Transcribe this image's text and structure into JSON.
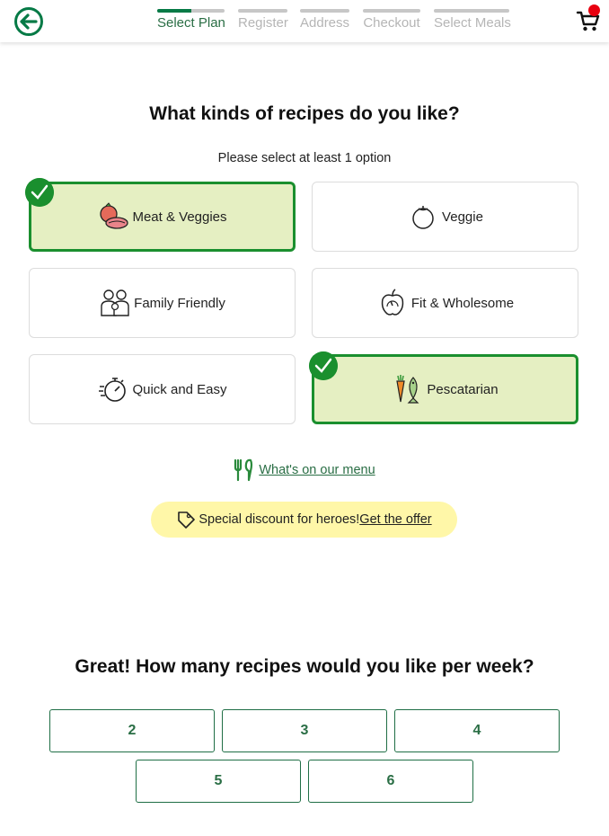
{
  "header": {
    "steps": [
      {
        "label": "Select Plan",
        "progress": 0.5,
        "active": true
      },
      {
        "label": "Register",
        "progress": 0,
        "active": false
      },
      {
        "label": "Address",
        "progress": 0,
        "active": false
      },
      {
        "label": "Checkout",
        "progress": 0,
        "active": false
      },
      {
        "label": "Select Meals",
        "progress": 0,
        "active": false
      }
    ],
    "cart_has_badge": true
  },
  "preferences": {
    "title": "What kinds of recipes do you like?",
    "hint": "Please select at least 1 option",
    "options": [
      {
        "label": "Meat & Veggies",
        "icon": "meat-veggies-icon",
        "selected": true
      },
      {
        "label": "Veggie",
        "icon": "veggie-icon",
        "selected": false
      },
      {
        "label": "Family Friendly",
        "icon": "family-icon",
        "selected": false
      },
      {
        "label": "Fit & Wholesome",
        "icon": "fit-apple-icon",
        "selected": false
      },
      {
        "label": "Quick and Easy",
        "icon": "stopwatch-icon",
        "selected": false
      },
      {
        "label": "Pescatarian",
        "icon": "fish-carrot-icon",
        "selected": true
      }
    ]
  },
  "menu_link": {
    "label": "What's on our menu",
    "icon": "fork-icon"
  },
  "promo": {
    "text": "Special discount for heroes!",
    "link": "Get the offer",
    "icon": "tag-icon"
  },
  "recipes_per_week": {
    "title": "Great! How many recipes would you like per week?",
    "options": [
      "2",
      "3",
      "4",
      "5",
      "6"
    ]
  },
  "colors": {
    "brand_green": "#067a46",
    "selected_bg": "#e5efc2",
    "selected_border": "#1a8f2e",
    "promo_bg": "#fff7a8",
    "badge_red": "#e8000f"
  }
}
